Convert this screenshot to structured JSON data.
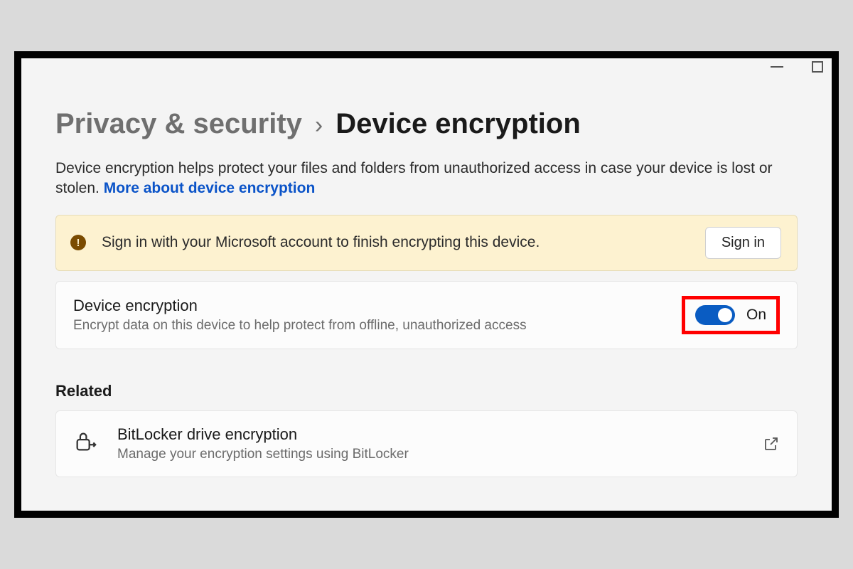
{
  "window": {
    "minimize": "−",
    "maximize": "☐"
  },
  "breadcrumb": {
    "parent": "Privacy & security",
    "separator": "›",
    "current": "Device encryption"
  },
  "description": {
    "text": "Device encryption helps protect your files and folders from unauthorized access in case your device is lost or stolen. ",
    "link": "More about device encryption"
  },
  "banner": {
    "icon_glyph": "!",
    "text": "Sign in with your Microsoft account to finish encrypting this device.",
    "button": "Sign in"
  },
  "setting": {
    "title": "Device encryption",
    "subtitle": "Encrypt data on this device to help protect from offline, unauthorized access",
    "state_label": "On"
  },
  "related": {
    "heading": "Related",
    "bitlocker": {
      "title": "BitLocker drive encryption",
      "subtitle": "Manage your encryption settings using BitLocker"
    }
  },
  "colors": {
    "accent": "#0a5cc2",
    "highlight": "#ff0000",
    "banner_bg": "#fdf2d0"
  }
}
